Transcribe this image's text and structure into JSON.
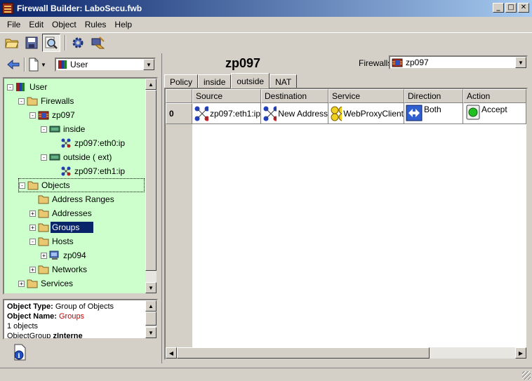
{
  "window": {
    "title": "Firewall Builder: LaboSecu.fwb"
  },
  "menu": [
    "File",
    "Edit",
    "Object",
    "Rules",
    "Help"
  ],
  "left": {
    "library": "User",
    "tree": [
      {
        "label": "User",
        "level": 0,
        "icon": "library",
        "exp": "-"
      },
      {
        "label": "Firewalls",
        "level": 1,
        "icon": "folder",
        "exp": "-"
      },
      {
        "label": "zp097",
        "level": 2,
        "icon": "firewall",
        "exp": "-"
      },
      {
        "label": "inside",
        "level": 3,
        "icon": "interface",
        "exp": "-"
      },
      {
        "label": "zp097:eth0:ip",
        "level": 4,
        "icon": "address",
        "exp": ""
      },
      {
        "label": "outside ( ext)",
        "level": 3,
        "icon": "interface",
        "exp": "-"
      },
      {
        "label": "zp097:eth1:ip",
        "level": 4,
        "icon": "address",
        "exp": ""
      },
      {
        "label": "Objects",
        "level": 1,
        "icon": "folder",
        "exp": "-",
        "focused": true
      },
      {
        "label": "Address Ranges",
        "level": 2,
        "icon": "folder",
        "exp": ""
      },
      {
        "label": "Addresses",
        "level": 2,
        "icon": "folder",
        "exp": "+"
      },
      {
        "label": "Groups",
        "level": 2,
        "icon": "folder",
        "exp": "+",
        "selected": true
      },
      {
        "label": "Hosts",
        "level": 2,
        "icon": "folder",
        "exp": "-"
      },
      {
        "label": "zp094",
        "level": 3,
        "icon": "host",
        "exp": "+"
      },
      {
        "label": "Networks",
        "level": 2,
        "icon": "folder",
        "exp": "+"
      },
      {
        "label": "Services",
        "level": 1,
        "icon": "folder",
        "exp": "+"
      }
    ],
    "info": {
      "type_label": "Object Type:",
      "type_value": "Group of Objects",
      "name_label": "Object Name:",
      "name_value": "Groups",
      "count": "1 objects",
      "group_prefix": "ObjectGroup",
      "group_name": "zInterne"
    }
  },
  "right": {
    "firewall_name": "zp097",
    "firewalls_label": "Firewalls:",
    "firewall_select": "zp097",
    "tabs": [
      "Policy",
      "inside",
      "outside",
      "NAT"
    ],
    "active_tab": 2,
    "columns": [
      "Source",
      "Destination",
      "Service",
      "Direction",
      "Action"
    ],
    "rules": [
      {
        "num": "0",
        "source": "zp097:eth1:ip",
        "destination": "New Address",
        "service": "WebProxyClient",
        "direction": "Both",
        "action": "Accept"
      }
    ]
  },
  "colors": {
    "tree_bg": "#ccffcc",
    "selection": "#0a246a",
    "title_start": "#0a246a",
    "title_end": "#a6caf0"
  }
}
